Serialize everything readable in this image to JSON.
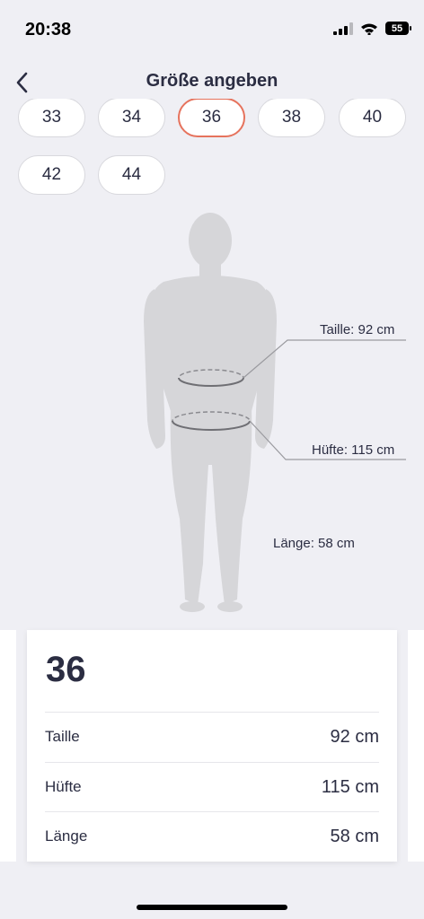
{
  "status": {
    "time": "20:38",
    "battery": "55"
  },
  "nav": {
    "title": "Größe angeben"
  },
  "sizes": [
    "33",
    "34",
    "36",
    "38",
    "40",
    "42",
    "44"
  ],
  "selected_size": "36",
  "measurements": {
    "waist_label": "Taille: 92 cm",
    "hip_label": "Hüfte: 115 cm",
    "length_label": "Länge: 58 cm"
  },
  "card": {
    "size": "36",
    "rows": [
      {
        "label": "Taille",
        "value": "92 cm"
      },
      {
        "label": "Hüfte",
        "value": "115 cm"
      },
      {
        "label": "Länge",
        "value": "58 cm"
      }
    ]
  },
  "colors": {
    "accent": "#e6735d",
    "background": "#efeff4",
    "text": "#2b2d42",
    "figure": "#d6d6d9"
  }
}
